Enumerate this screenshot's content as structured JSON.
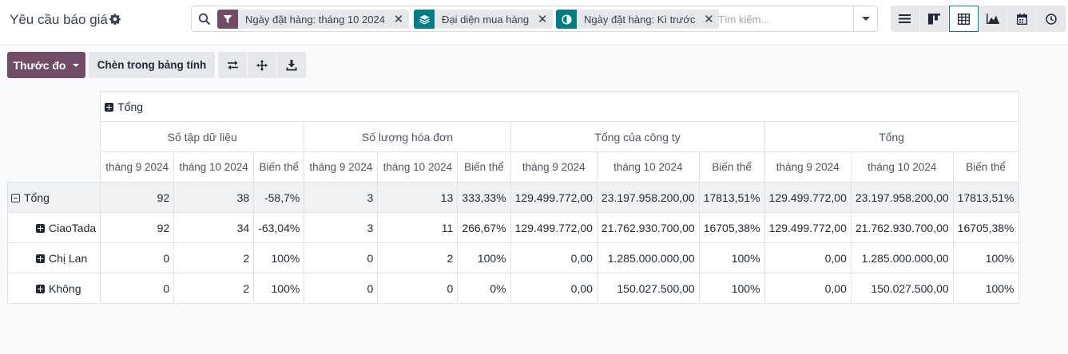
{
  "header": {
    "title": "Yêu cầu báo giá"
  },
  "search": {
    "facets": [
      {
        "icon": "filter-icon",
        "color": "#714b67",
        "label": "Ngày đặt hàng: tháng 10 2024"
      },
      {
        "icon": "layers-icon",
        "color": "#017e84",
        "label": "Đại diện mua hàng"
      },
      {
        "icon": "compare-icon",
        "color": "#017e84",
        "label": "Ngày đặt hàng: Kì trước"
      }
    ],
    "placeholder": "Tìm kiếm..."
  },
  "views": [
    "list-view",
    "kanban-view",
    "pivot-view",
    "graph-view",
    "calendar-view",
    "activity-view"
  ],
  "active_view": "pivot-view",
  "controls": {
    "measures_label": "Thước đo",
    "insert_label": "Chèn trong bảng tính"
  },
  "pivot": {
    "col_total": "Tổng",
    "measures": [
      "Số tập dữ liệu",
      "Số lượng hóa đơn",
      "Tổng của công ty",
      "Tổng"
    ],
    "subcols": [
      "tháng 9 2024",
      "tháng 10 2024",
      "Biến thể"
    ],
    "rows": [
      {
        "label": "Tổng",
        "values": [
          "92",
          "38",
          "-58,7%",
          "3",
          "13",
          "333,33%",
          "129.499.772,00",
          "23.197.958.200,00",
          "17813,51%",
          "129.499.772,00",
          "23.197.958.200,00",
          "17813,51%"
        ]
      },
      {
        "label": "CiaoTada",
        "values": [
          "92",
          "34",
          "-63,04%",
          "3",
          "11",
          "266,67%",
          "129.499.772,00",
          "21.762.930.700,00",
          "16705,38%",
          "129.499.772,00",
          "21.762.930.700,00",
          "16705,38%"
        ]
      },
      {
        "label": "Chị Lan",
        "values": [
          "0",
          "2",
          "100%",
          "0",
          "2",
          "100%",
          "0,00",
          "1.285.000.000,00",
          "100%",
          "0,00",
          "1.285.000.000,00",
          "100%"
        ]
      },
      {
        "label": "Không",
        "values": [
          "0",
          "2",
          "100%",
          "0",
          "0",
          "0%",
          "0,00",
          "150.027.500,00",
          "100%",
          "0,00",
          "150.027.500,00",
          "100%"
        ]
      }
    ]
  },
  "colors": {
    "primary": "#714b67",
    "accent": "#017e84",
    "negative": "#d23f3a",
    "positive": "#28a745"
  }
}
